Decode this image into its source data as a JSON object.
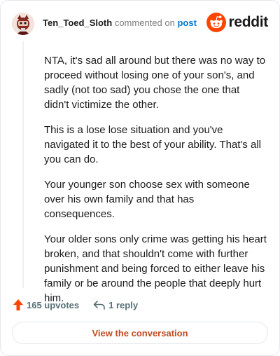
{
  "header": {
    "username": "Ten_Toed_Sloth",
    "commented_text": "commented on",
    "post_link": "post",
    "brand_name": "reddit"
  },
  "comment": {
    "paragraphs": [
      "NTA, it's sad all around but there was no way to proceed without losing one of your son's, and sadly (not too sad) you chose the one that didn't victimize the other.",
      "This is a lose lose situation and you've navigated it to the best of your ability. That's all you can do.",
      "Your younger son choose sex with someone over his own family and that has consequences.",
      "Your older sons only crime was getting his heart broken, and that shouldn't come with further punishment and being forced to either leave his family or be around the people that deeply hurt him."
    ]
  },
  "footer": {
    "upvotes": "165 upvotes",
    "replies": "1 reply",
    "cta_label": "View the conversation"
  },
  "icons": {
    "upvote": "upvote-arrow-icon",
    "reply": "reply-arrow-icon",
    "brand": "reddit-snoo-icon",
    "avatar": "user-avatar"
  },
  "colors": {
    "brand_orange": "#ff4500",
    "link_blue": "#0079d3",
    "cta_text": "#c24a21",
    "muted_text": "#576f76"
  }
}
